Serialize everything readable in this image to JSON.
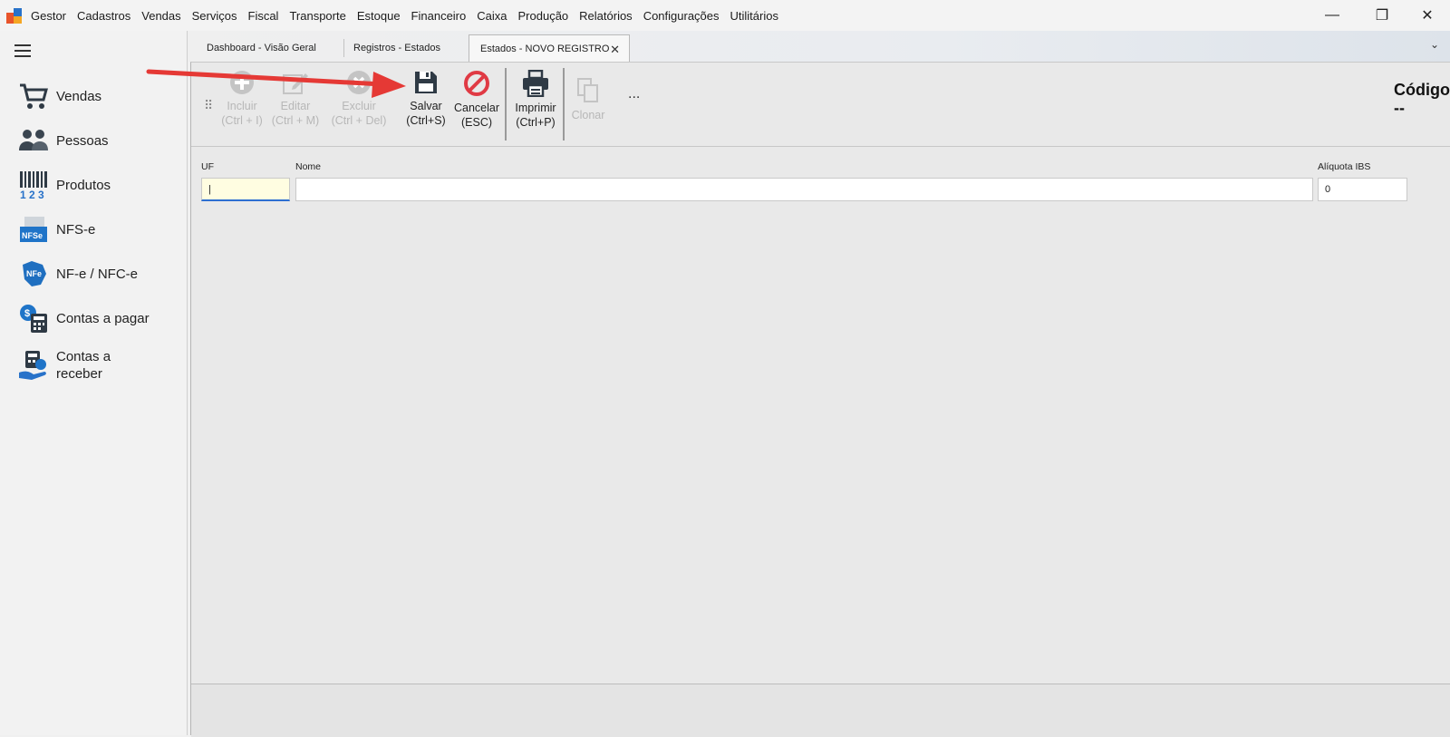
{
  "menubar": {
    "items": [
      "Gestor",
      "Cadastros",
      "Vendas",
      "Serviços",
      "Fiscal",
      "Transporte",
      "Estoque",
      "Financeiro",
      "Caixa",
      "Produção",
      "Relatórios",
      "Configurações",
      "Utilitários"
    ],
    "window_controls": {
      "minimize": "—",
      "maximize": "❐",
      "close": "✕"
    }
  },
  "sidebar": {
    "items": [
      {
        "label": "Vendas",
        "icon": "cart-icon"
      },
      {
        "label": "Pessoas",
        "icon": "people-icon"
      },
      {
        "label": "Produtos",
        "icon": "barcode-icon"
      },
      {
        "label": "NFS-e",
        "icon": "nfse-icon"
      },
      {
        "label": "NF-e / NFC-e",
        "icon": "nfe-icon"
      },
      {
        "label": "Contas a pagar",
        "icon": "calculator-pay-icon"
      },
      {
        "label": "Contas a receber",
        "icon": "calculator-receive-icon"
      }
    ]
  },
  "tabs": [
    {
      "label": "Dashboard - Visão Geral",
      "active": false
    },
    {
      "label": "Registros - Estados",
      "active": false
    },
    {
      "label": "Estados - NOVO REGISTRO",
      "active": true,
      "close": "✕"
    }
  ],
  "tab_overflow": "⌄",
  "toolbar": {
    "incluir": {
      "label": "Incluir",
      "shortcut": "(Ctrl + I)",
      "enabled": false
    },
    "editar": {
      "label": "Editar",
      "shortcut": "(Ctrl + M)",
      "enabled": false
    },
    "excluir": {
      "label": "Excluir",
      "shortcut": "(Ctrl + Del)",
      "enabled": false
    },
    "salvar": {
      "label": "Salvar",
      "shortcut": "(Ctrl+S)",
      "enabled": true
    },
    "cancelar": {
      "label": "Cancelar",
      "shortcut": "(ESC)",
      "enabled": true
    },
    "imprimir": {
      "label": "Imprimir",
      "shortcut": "(Ctrl+P)",
      "enabled": true
    },
    "clonar": {
      "label": "Clonar",
      "enabled": false
    },
    "more": "..."
  },
  "record": {
    "codigo_label": "Código",
    "codigo_value": "--"
  },
  "form": {
    "uf": {
      "label": "UF",
      "value": "|"
    },
    "nome": {
      "label": "Nome",
      "value": ""
    },
    "aliquota_ibs": {
      "label": "Alíquota IBS",
      "value": "0"
    }
  },
  "colors": {
    "accent_blue": "#2d6fd1",
    "cancel_red": "#e03a44",
    "arrow_red": "#e53935",
    "uf_bg": "#fffde1"
  }
}
